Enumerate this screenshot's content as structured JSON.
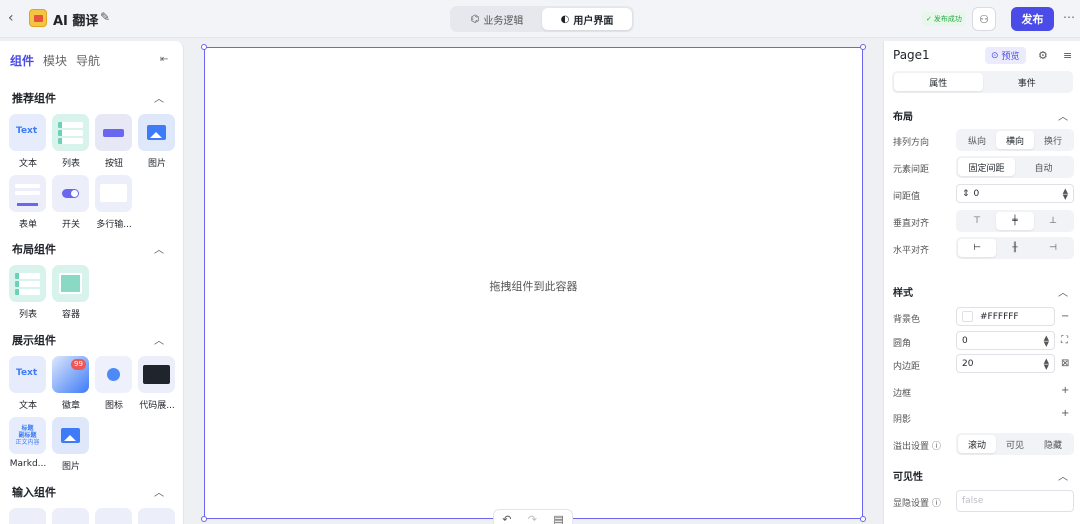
{
  "header": {
    "app_title": "AI 翻译",
    "modes": [
      {
        "label": "业务逻辑",
        "active": false
      },
      {
        "label": "用户界面",
        "active": true
      }
    ],
    "publish_status": "发布成功",
    "publish_label": "发布"
  },
  "left_panel": {
    "tabs": [
      "组件",
      "模块",
      "导航"
    ],
    "sections": [
      {
        "title": "推荐组件",
        "items": [
          "文本",
          "列表",
          "按钮",
          "图片",
          "表单",
          "开关",
          "多行输..."
        ]
      },
      {
        "title": "布局组件",
        "items": [
          "列表",
          "容器"
        ]
      },
      {
        "title": "展示组件",
        "items": [
          "文本",
          "徽章",
          "图标",
          "代码展...",
          "Markd...",
          "图片"
        ]
      },
      {
        "title": "输入组件",
        "items": []
      }
    ],
    "tile_text": "Text",
    "badge_count": "99",
    "md_lines": [
      "标题",
      "副标题",
      "正文内容"
    ]
  },
  "canvas": {
    "drop_hint": "拖拽组件到此容器"
  },
  "right_panel": {
    "page_name": "Page1",
    "preview_label": "预览",
    "tabs": [
      {
        "label": "属性",
        "active": true
      },
      {
        "label": "事件",
        "active": false
      }
    ],
    "layout": {
      "title": "布局",
      "direction_label": "排列方向",
      "direction_options": [
        "纵向",
        "横向",
        "换行"
      ],
      "direction_selected": "横向",
      "spacing_label": "元素间距",
      "spacing_options": [
        "固定间距",
        "自动"
      ],
      "spacing_selected": "固定间距",
      "gap_label": "间距值",
      "gap_value": "0",
      "valign_label": "垂直对齐",
      "halign_label": "水平对齐"
    },
    "style": {
      "title": "样式",
      "bg_label": "背景色",
      "bg_value": "#FFFFFF",
      "radius_label": "圆角",
      "radius_value": "0",
      "padding_label": "内边距",
      "padding_value": "20",
      "border_label": "边框",
      "shadow_label": "阴影",
      "overflow_label": "溢出设置",
      "overflow_options": [
        "滚动",
        "可见",
        "隐藏"
      ],
      "overflow_selected": "滚动"
    },
    "visibility": {
      "title": "可见性",
      "hidden_label": "显隐设置",
      "hidden_placeholder": "false"
    }
  },
  "colors": {
    "accent": "#4b4ce8",
    "success": "#28a745",
    "canvas_border": "#6b66f0"
  }
}
